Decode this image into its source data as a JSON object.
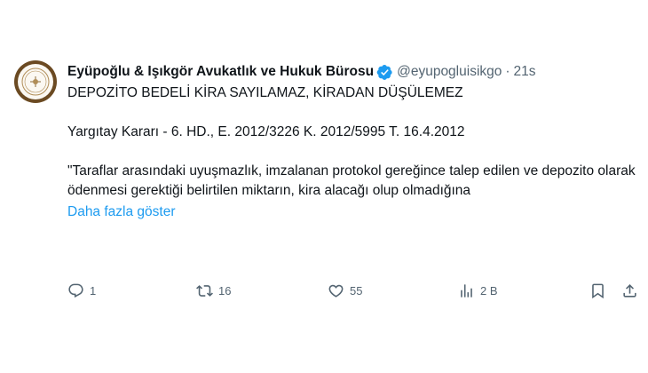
{
  "author": {
    "name": "Eyüpoğlu & Işıkgör Avukatlık ve Hukuk Bürosu",
    "handle": "@eyupogluisikgo",
    "separator": "·",
    "time": "21s"
  },
  "tweet": {
    "headline": "DEPOZİTO BEDELİ KİRA SAYILAMAZ, KİRADAN DÜŞÜLEMEZ",
    "citation": "Yargıtay Kararı - 6. HD., E. 2012/3226 K. 2012/5995 T. 16.4.2012",
    "quote": "\"Taraflar arasındaki uyuşmazlık, imzalanan protokol gereğince talep edilen ve depozito olarak ödenmesi gerektiği belirtilen miktarın, kira alacağı olup olmadığına",
    "show_more": "Daha fazla göster"
  },
  "actions": {
    "replies": "1",
    "retweets": "16",
    "likes": "55",
    "views": "2 B"
  },
  "colors": {
    "accent": "#1d9bf0",
    "muted": "#536471",
    "text": "#0f1419",
    "avatar_frame": "#6b4a22"
  },
  "icons": [
    "verified-icon",
    "reply-icon",
    "retweet-icon",
    "like-icon",
    "views-icon",
    "bookmark-icon",
    "share-icon"
  ]
}
